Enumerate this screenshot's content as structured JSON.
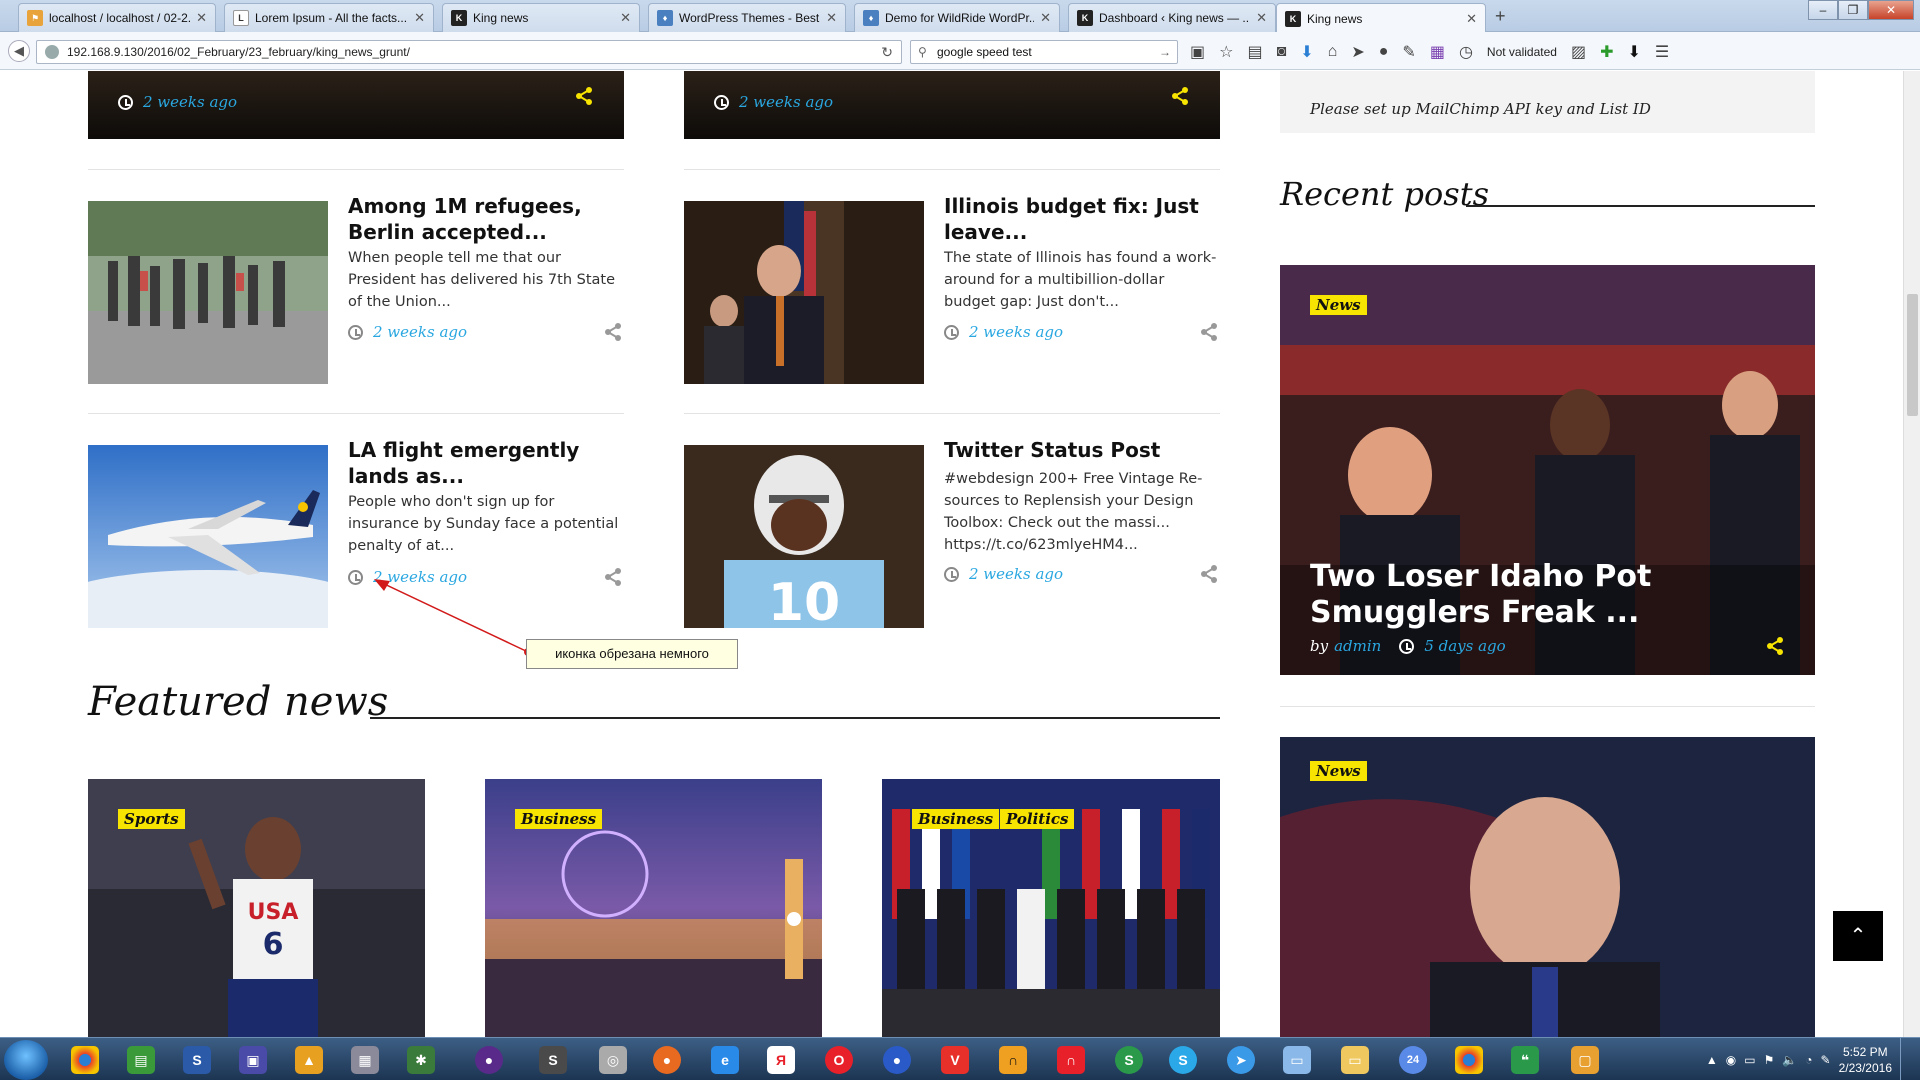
{
  "browser": {
    "tabs": [
      {
        "title": "localhost / localhost / 02-2...",
        "favicon": "phpmyadmin-icon",
        "color": "#e8a33b"
      },
      {
        "title": "Lorem Ipsum - All the facts...",
        "favicon": "lorem-icon",
        "color": "#666666"
      },
      {
        "title": "King news",
        "favicon": "king-icon",
        "color": "#222222"
      },
      {
        "title": "WordPress Themes - Best ...",
        "favicon": "shield-icon",
        "color": "#4a7fc0"
      },
      {
        "title": "Demo for WildRide WordPr...",
        "favicon": "shield-icon",
        "color": "#4a7fc0"
      },
      {
        "title": "Dashboard ‹ King news — ...",
        "favicon": "king-icon",
        "color": "#222222"
      },
      {
        "title": "King news",
        "favicon": "king-icon",
        "color": "#222222"
      }
    ],
    "new_tab": "+",
    "url": "192.168.9.130/2016/02_February/23_february/king_news_grunt/",
    "search_query": "google speed test",
    "not_validated": "Not validated"
  },
  "page": {
    "top_cards": [
      {
        "time": "2 weeks ago"
      },
      {
        "time": "2 weeks ago"
      }
    ],
    "mailchimp_notice": "Please set up MailChimp API key and List ID",
    "posts": [
      {
        "title": "Among 1M refugees, Berlin accepted...",
        "excerpt": "When people tell me that our President has delivered his 7th State of the Union...",
        "time": "2 weeks ago"
      },
      {
        "title": "Illinois budget fix: Just leave...",
        "excerpt": "The state of Illinois has found a work-around for a multibillion-dollar budget gap: Just don't...",
        "time": "2 weeks ago"
      },
      {
        "title": "LA flight emergently lands as...",
        "excerpt": "People who don't sign up for insurance by Sunday face a potential penalty of at...",
        "time": "2 weeks ago"
      },
      {
        "title": "Twitter Status Post",
        "excerpt": "#webdesign 200+ Free Vintage Re-sources to Replensish your Design Toolbox: Check out the massi... https://t.co/623mlyeHM4...",
        "time": "2 weeks ago"
      }
    ],
    "annotation": "иконка обрезана немного",
    "featured_heading": "Featured news",
    "featured": [
      {
        "cats": [
          "Sports"
        ]
      },
      {
        "cats": [
          "Business"
        ]
      },
      {
        "cats": [
          "Business",
          "Politics"
        ]
      }
    ],
    "recent_heading": "Recent posts",
    "recent": [
      {
        "cat": "News",
        "title": "Two Loser Idaho Pot Smugglers Freak ...",
        "by": "by",
        "author": "admin",
        "time": "5 days ago"
      },
      {
        "cat": "News"
      }
    ],
    "to_top": "⌃"
  },
  "taskbar": {
    "time": "5:52 PM",
    "date": "2/23/2016",
    "badge_24": "24"
  },
  "colors": {
    "accent": "#2aa7e0",
    "category": "#f7e400",
    "share_light": "#f7e400"
  }
}
